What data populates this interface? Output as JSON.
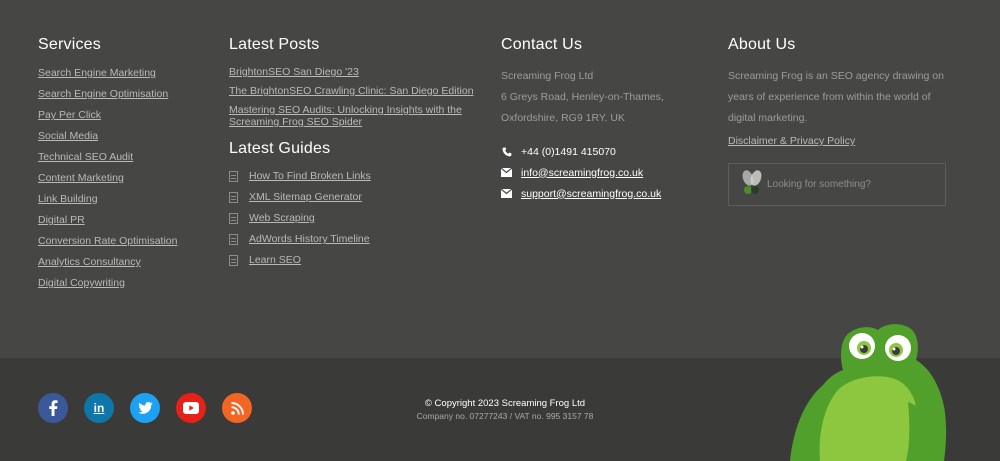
{
  "services": {
    "heading": "Services",
    "items": [
      "Search Engine Marketing",
      "Search Engine Optimisation",
      "Pay Per Click",
      "Social Media",
      "Technical SEO Audit",
      "Content Marketing",
      "Link Building",
      "Digital PR",
      "Conversion Rate Optimisation",
      "Analytics Consultancy",
      "Digital Copywriting"
    ]
  },
  "latest_posts": {
    "heading": "Latest Posts",
    "items": [
      "BrightonSEO San Diego '23",
      "The BrightonSEO Crawling Clinic: San Diego Edition",
      "Mastering SEO Audits: Unlocking Insights with the Screaming Frog SEO Spider"
    ]
  },
  "latest_guides": {
    "heading": "Latest Guides",
    "items": [
      "How To Find Broken Links",
      "XML Sitemap Generator",
      "Web Scraping",
      "AdWords History Timeline",
      "Learn SEO"
    ]
  },
  "contact": {
    "heading": "Contact Us",
    "company": "Screaming Frog Ltd",
    "address1": "6 Greys Road, Henley-on-Thames,",
    "address2": "Oxfordshire, RG9 1RY. UK",
    "phone": "+44 (0)1491 415070",
    "email_info": "info@screamingfrog.co.uk",
    "email_support": "support@screamingfrog.co.uk"
  },
  "about": {
    "heading": "About Us",
    "text": "Screaming Frog is an SEO agency drawing on years of experience from within the world of digital marketing.",
    "disclaimer": "Disclaimer & Privacy Policy",
    "search_placeholder": "Looking for something?"
  },
  "social": [
    {
      "name": "facebook",
      "glyph": "f",
      "color": "#3b5998"
    },
    {
      "name": "linkedin",
      "glyph": "in",
      "color": "#0e76a8"
    },
    {
      "name": "twitter",
      "glyph": "t",
      "color": "#1da1f2"
    },
    {
      "name": "youtube",
      "glyph": "▶",
      "color": "#e62117"
    },
    {
      "name": "rss",
      "glyph": "rss",
      "color": "#f26522"
    }
  ],
  "copyright": {
    "line1": "© Copyright 2023 Screaming Frog Ltd",
    "line2": "Company no. 07277243 / VAT no. 995 3157 78"
  },
  "colors": {
    "frog_dark": "#52a02c",
    "frog_light": "#8dc63f",
    "bg_top": "#464745",
    "bg_bottom": "#3a3b39"
  }
}
